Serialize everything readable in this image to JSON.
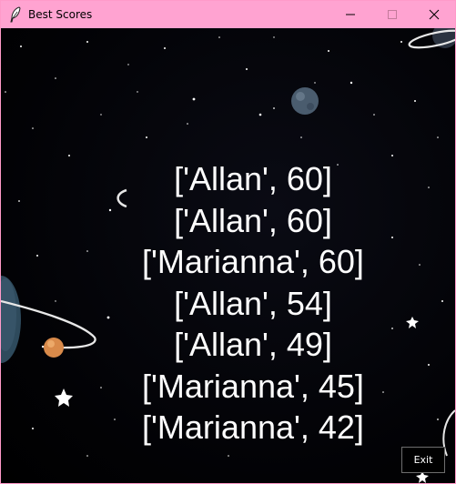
{
  "window": {
    "title": "Best Scores",
    "icon": "feather-icon",
    "controls": {
      "minimize_icon": "minimize-icon",
      "maximize_icon": "maximize-icon",
      "close_icon": "close-icon"
    },
    "titlebar_color": "#ffa3d1"
  },
  "scores": [
    "['Allan', 60]",
    "['Allan', 60]",
    "['Marianna', 60]",
    "['Allan', 54]",
    "['Allan', 49]",
    "['Marianna', 45]",
    "['Marianna', 42]"
  ],
  "exit_button": {
    "label": "Exit"
  },
  "background": "space-starfield"
}
